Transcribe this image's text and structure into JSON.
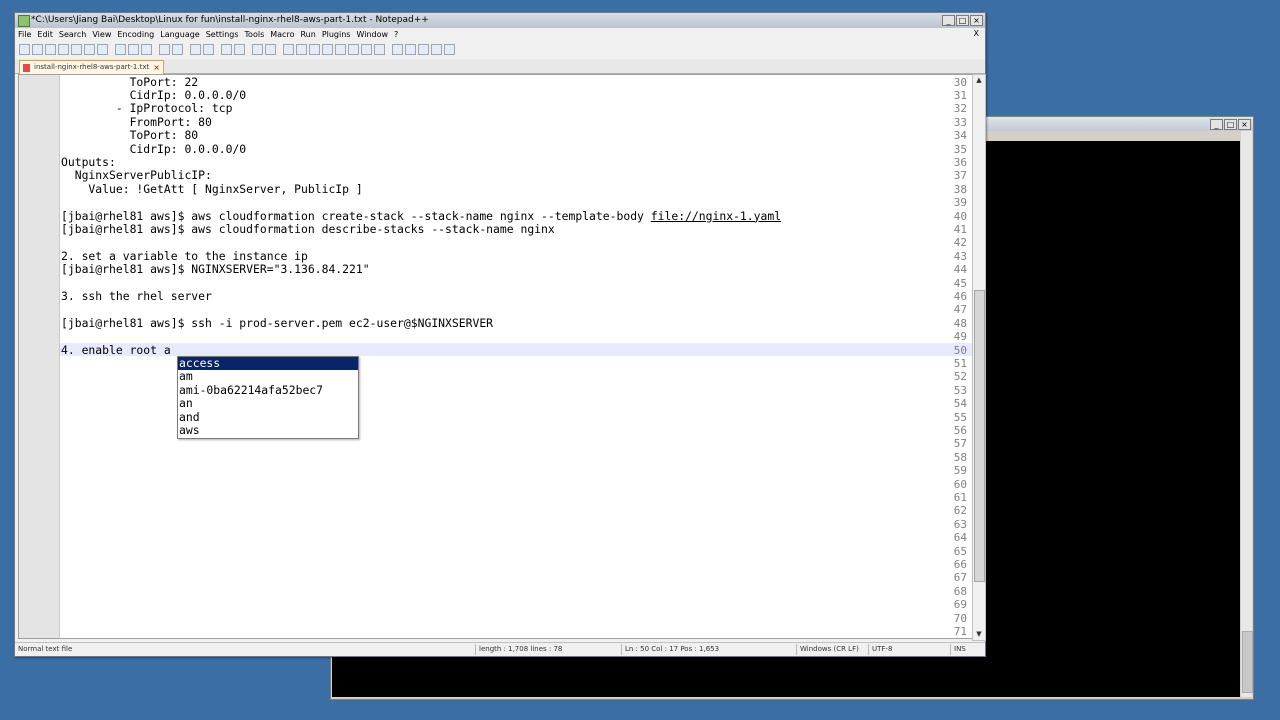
{
  "title": "*C:\\Users\\Jiang Bai\\Desktop\\Linux for fun\\install-nginx-rhel8-aws-part-1.txt - Notepad++",
  "menu": [
    "File",
    "Edit",
    "Search",
    "View",
    "Encoding",
    "Language",
    "Settings",
    "Tools",
    "Macro",
    "Run",
    "Plugins",
    "Window",
    "?"
  ],
  "menu_close": "X",
  "tab": {
    "label": "install-nginx-rhel8-aws-part-1.txt"
  },
  "lines": [
    {
      "n": "30",
      "t": "          ToPort: 22"
    },
    {
      "n": "31",
      "t": "          CidrIp: 0.0.0.0/0"
    },
    {
      "n": "32",
      "t": "        - IpProtocol: tcp"
    },
    {
      "n": "33",
      "t": "          FromPort: 80"
    },
    {
      "n": "34",
      "t": "          ToPort: 80"
    },
    {
      "n": "35",
      "t": "          CidrIp: 0.0.0.0/0"
    },
    {
      "n": "36",
      "t": "Outputs:"
    },
    {
      "n": "37",
      "t": "  NginxServerPublicIP:"
    },
    {
      "n": "38",
      "t": "    Value: !GetAtt [ NginxServer, PublicIp ]"
    },
    {
      "n": "39",
      "t": ""
    },
    {
      "n": "40",
      "t": "[jbai@rhel81 aws]$ aws cloudformation create-stack --stack-name nginx --template-body ",
      "link": "file://nginx-1.yaml"
    },
    {
      "n": "41",
      "t": "[jbai@rhel81 aws]$ aws cloudformation describe-stacks --stack-name nginx"
    },
    {
      "n": "42",
      "t": ""
    },
    {
      "n": "43",
      "t": "2. set a variable to the instance ip"
    },
    {
      "n": "44",
      "t": "[jbai@rhel81 aws]$ NGINXSERVER=\"3.136.84.221\""
    },
    {
      "n": "45",
      "t": ""
    },
    {
      "n": "46",
      "t": "3. ssh the rhel server"
    },
    {
      "n": "47",
      "t": ""
    },
    {
      "n": "48",
      "t": "[jbai@rhel81 aws]$ ssh -i prod-server.pem ec2-user@$NGINXSERVER"
    },
    {
      "n": "49",
      "t": ""
    },
    {
      "n": "50",
      "t": "4. enable root a"
    },
    {
      "n": "51",
      "t": ""
    },
    {
      "n": "52",
      "t": ""
    },
    {
      "n": "53",
      "t": ""
    },
    {
      "n": "54",
      "t": ""
    },
    {
      "n": "55",
      "t": ""
    },
    {
      "n": "56",
      "t": ""
    },
    {
      "n": "57",
      "t": ""
    },
    {
      "n": "58",
      "t": ""
    },
    {
      "n": "59",
      "t": ""
    },
    {
      "n": "60",
      "t": ""
    },
    {
      "n": "61",
      "t": ""
    },
    {
      "n": "62",
      "t": ""
    },
    {
      "n": "63",
      "t": ""
    },
    {
      "n": "64",
      "t": ""
    },
    {
      "n": "65",
      "t": ""
    },
    {
      "n": "66",
      "t": ""
    },
    {
      "n": "67",
      "t": ""
    },
    {
      "n": "68",
      "t": ""
    },
    {
      "n": "69",
      "t": ""
    },
    {
      "n": "70",
      "t": ""
    },
    {
      "n": "71",
      "t": ""
    }
  ],
  "autocomplete": [
    "access",
    "am",
    "ami-0ba62214afa52bec7",
    "an",
    "and",
    "aws"
  ],
  "autocomplete_selected": 0,
  "status": {
    "type": "Normal text file",
    "length": "length : 1,708    lines : 78",
    "pos": "Ln : 50    Col : 17    Pos : 1,653",
    "eol": "Windows (CR LF)",
    "enc": "UTF-8",
    "mode": "INS"
  },
  "colors": {
    "desktop": "#3a6ea5",
    "selection": "#0a246a",
    "current_line": "#e8e8ff"
  }
}
